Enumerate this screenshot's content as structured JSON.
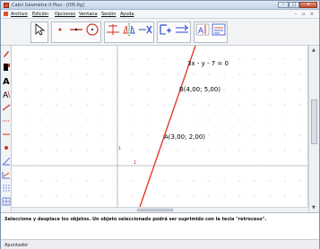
{
  "window": {
    "title": "Cabri Géomètre II Plus - [f05.fig]",
    "min_label": "–",
    "max_label": "□",
    "close_label": "×"
  },
  "menu": {
    "items": [
      "Archivo",
      "Edición",
      "Opciones",
      "Ventana",
      "Sesión",
      "Ayuda"
    ],
    "mdi_controls": "– ▫ ×"
  },
  "canvas": {
    "equation_label": "3x - y - 7 = 0",
    "point_b_label": "B(4,00; 5,00)",
    "point_a_label": "A(3,00; 2,00)",
    "unit_y_label": "1",
    "unit_x_label": "1",
    "line_color": "#e2301b",
    "axis_color": "#7a7a7a"
  },
  "help": {
    "text": "Seleccione y desplace los objetos. Un objeto seleccionado podrá ser suprimido con la tecla \"retroceso\"."
  },
  "status": {
    "text": "Apuntador"
  },
  "icons": {
    "toolbar": [
      "pointer-icon",
      "point-icon",
      "line-icon",
      "circle-icon",
      "perpendicular-icon",
      "reflection-icon",
      "measure-icon",
      "calculate-icon",
      "label-icon",
      "display-icon"
    ],
    "lefttools": [
      "pencil-icon",
      "fill-color-icon",
      "text-style-icon",
      "font-icon",
      "line-thickness-icon",
      "dotted-style-icon",
      "point-style-icon",
      "marker-icon",
      "axis-style-icon",
      "grid-icon",
      "coordinate-icon"
    ]
  }
}
